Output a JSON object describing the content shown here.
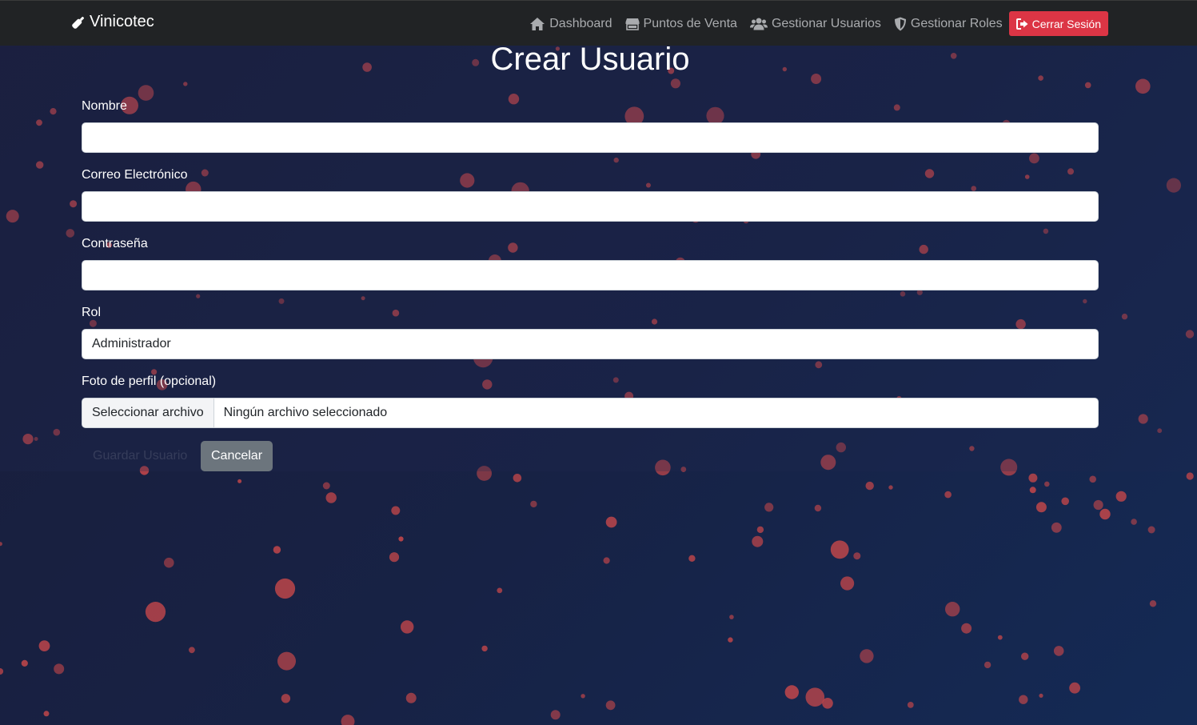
{
  "navbar": {
    "brand": "Vinicotec",
    "links": [
      {
        "label": "Dashboard",
        "icon": "home-icon"
      },
      {
        "label": "Puntos de Venta",
        "icon": "store-icon"
      },
      {
        "label": "Gestionar Usuarios",
        "icon": "users-icon"
      },
      {
        "label": "Gestionar Roles",
        "icon": "shield-icon"
      }
    ],
    "logout_label": "Cerrar Sesión"
  },
  "form": {
    "title": "Crear Usuario",
    "fields": {
      "nombre_label": "Nombre",
      "nombre_value": "",
      "correo_label": "Correo Electrónico",
      "correo_value": "",
      "contrasena_label": "Contraseña",
      "contrasena_value": "",
      "rol_label": "Rol",
      "rol_value": "Administrador",
      "foto_label": "Foto de perfil (opcional)",
      "foto_button": "Seleccionar archivo",
      "foto_status": "Ningún archivo seleccionado"
    },
    "submit_label": "Guardar Usuario",
    "cancel_label": "Cancelar"
  },
  "colors": {
    "navbar": "#212325",
    "logout": "#dc3545",
    "cancel": "#6c757d",
    "particle": "#c0464a"
  }
}
